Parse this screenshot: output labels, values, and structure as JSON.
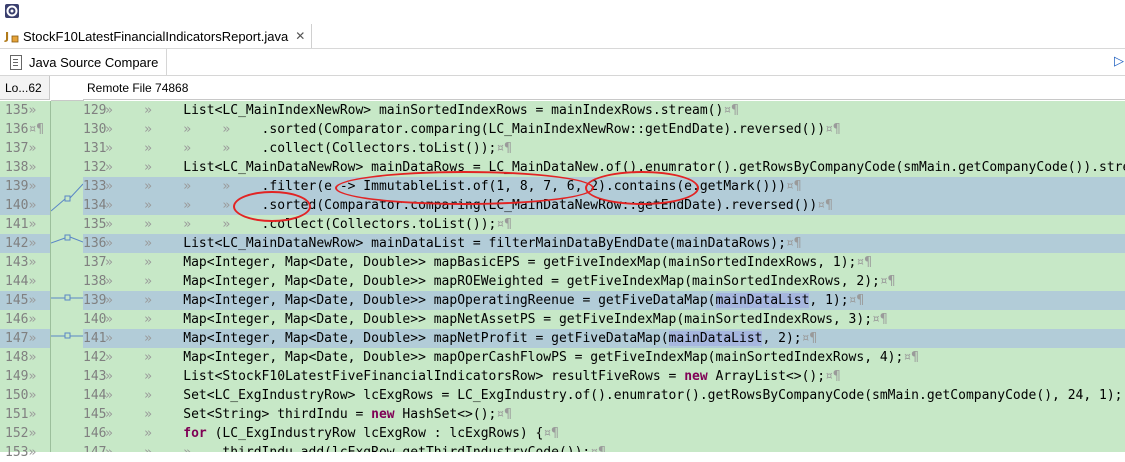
{
  "window": {
    "app_icon": "eclipse-gear-icon"
  },
  "editor_tab": {
    "icon": "java-file-icon",
    "title": "StockF10LatestFinancialIndicatorsReport.java",
    "close": "✕"
  },
  "compare_tab": {
    "icon": "document-icon",
    "label": "Java Source Compare"
  },
  "headers": {
    "left": "Lo...62",
    "right": "Remote File 74868"
  },
  "colors": {
    "pane_bg": "#c7e8c7",
    "selected_bg": "#b2ccd8",
    "keyword": "#7f0055",
    "annotation": "#e22424"
  },
  "left_lines": [
    {
      "num": "135",
      "suffix": "»"
    },
    {
      "num": "136",
      "suffix": "¤¶"
    },
    {
      "num": "137",
      "suffix": "»"
    },
    {
      "num": "138",
      "suffix": "»"
    },
    {
      "num": "139",
      "suffix": "»"
    },
    {
      "num": "140",
      "suffix": "»"
    },
    {
      "num": "141",
      "suffix": "»"
    },
    {
      "num": "142",
      "suffix": "»"
    },
    {
      "num": "143",
      "suffix": "»"
    },
    {
      "num": "144",
      "suffix": "»"
    },
    {
      "num": "145",
      "suffix": "»"
    },
    {
      "num": "146",
      "suffix": "»"
    },
    {
      "num": "147",
      "suffix": "»"
    },
    {
      "num": "148",
      "suffix": "»"
    },
    {
      "num": "149",
      "suffix": "»"
    },
    {
      "num": "150",
      "suffix": "»"
    },
    {
      "num": "151",
      "suffix": "»"
    },
    {
      "num": "152",
      "suffix": "»"
    },
    {
      "num": "153",
      "suffix": "»"
    }
  ],
  "right_lines": [
    {
      "num": "129",
      "ind": "»    »    ",
      "code": "List<LC_MainIndexNewRow> mainSortedIndexRows = mainIndexRows.stream()",
      "end": "¤¶"
    },
    {
      "num": "130",
      "ind": "»    »    »    »    ",
      "code": ".sorted(Comparator.comparing(LC_MainIndexNewRow::getEndDate).reversed())",
      "end": "¤¶"
    },
    {
      "num": "131",
      "ind": "»    »    »    »    ",
      "code": ".collect(Collectors.toList());",
      "end": "¤¶"
    },
    {
      "num": "132",
      "ind": "»    »    ",
      "code": "List<LC_MainDataNewRow> mainDataRows = LC_MainDataNew.of().enumrator().getRowsByCompanyCode(smMain.getCompanyCode()).stream()",
      "end": ""
    },
    {
      "num": "133",
      "ind": "»    »    »    »    ",
      "code": ".filter(e -> ImmutableList.of(1, 8, 7, 6, 2).contains(e.getMark()))",
      "end": "¤¶"
    },
    {
      "num": "134",
      "ind": "»    »    »    »    ",
      "code": ".sorted(Comparator.comparing(LC_MainDataNewRow::getEndDate).reversed())",
      "end": "¤¶"
    },
    {
      "num": "135",
      "ind": "»    »    »    »    ",
      "code": ".collect(Collectors.toList());",
      "end": "¤¶"
    },
    {
      "num": "136",
      "ind": "»    »    ",
      "code": "List<LC_MainDataNewRow> mainDataList = filterMainDataByEndDate(mainDataRows);",
      "end": "¤¶"
    },
    {
      "num": "137",
      "ind": "»    »    ",
      "code": "Map<Integer, Map<Date, Double>> mapBasicEPS = getFiveIndexMap(mainSortedIndexRows, 1);",
      "end": "¤¶"
    },
    {
      "num": "138",
      "ind": "»    »    ",
      "code": "Map<Integer, Map<Date, Double>> mapROEWeighted = getFiveIndexMap(mainSortedIndexRows, 2);",
      "end": "¤¶"
    },
    {
      "num": "139",
      "ind": "»    »    ",
      "code": "Map<Integer, Map<Date, Double>> mapOperatingReenue = getFiveDataMap(mainDataList, 1);",
      "end": "¤¶"
    },
    {
      "num": "140",
      "ind": "»    »    ",
      "code": "Map<Integer, Map<Date, Double>> mapNetAssetPS = getFiveIndexMap(mainSortedIndexRows, 3);",
      "end": "¤¶"
    },
    {
      "num": "141",
      "ind": "»    »    ",
      "code": "Map<Integer, Map<Date, Double>> mapNetProfit = getFiveDataMap(mainDataList, 2);",
      "end": "¤¶"
    },
    {
      "num": "142",
      "ind": "»    »    ",
      "code": "Map<Integer, Map<Date, Double>> mapOperCashFlowPS = getFiveIndexMap(mainSortedIndexRows, 4);",
      "end": "¤¶"
    },
    {
      "num": "143",
      "ind": "»    »    ",
      "code": "List<StockF10LatestFiveFinancialIndicatorsRow> resultFiveRows = new ArrayList<>();",
      "end": "¤¶"
    },
    {
      "num": "144",
      "ind": "»    »    ",
      "code": "Set<LC_ExgIndustryRow> lcExgRows = LC_ExgIndustry.of().enumrator().getRowsByCompanyCode(smMain.getCompanyCode(), 24, 1);",
      "end": ""
    },
    {
      "num": "145",
      "ind": "»    »    ",
      "code": "Set<String> thirdIndu = new HashSet<>();",
      "end": "¤¶"
    },
    {
      "num": "146",
      "ind": "»    »    ",
      "code": "for (LC_ExgIndustryRow lcExgRow : lcExgRows) {",
      "end": "¤¶"
    },
    {
      "num": "147",
      "ind": "»    »    »    ",
      "code": "thirdIndu.add(lcExgRow.getThirdIndustryCode());",
      "end": "¤¶"
    }
  ]
}
